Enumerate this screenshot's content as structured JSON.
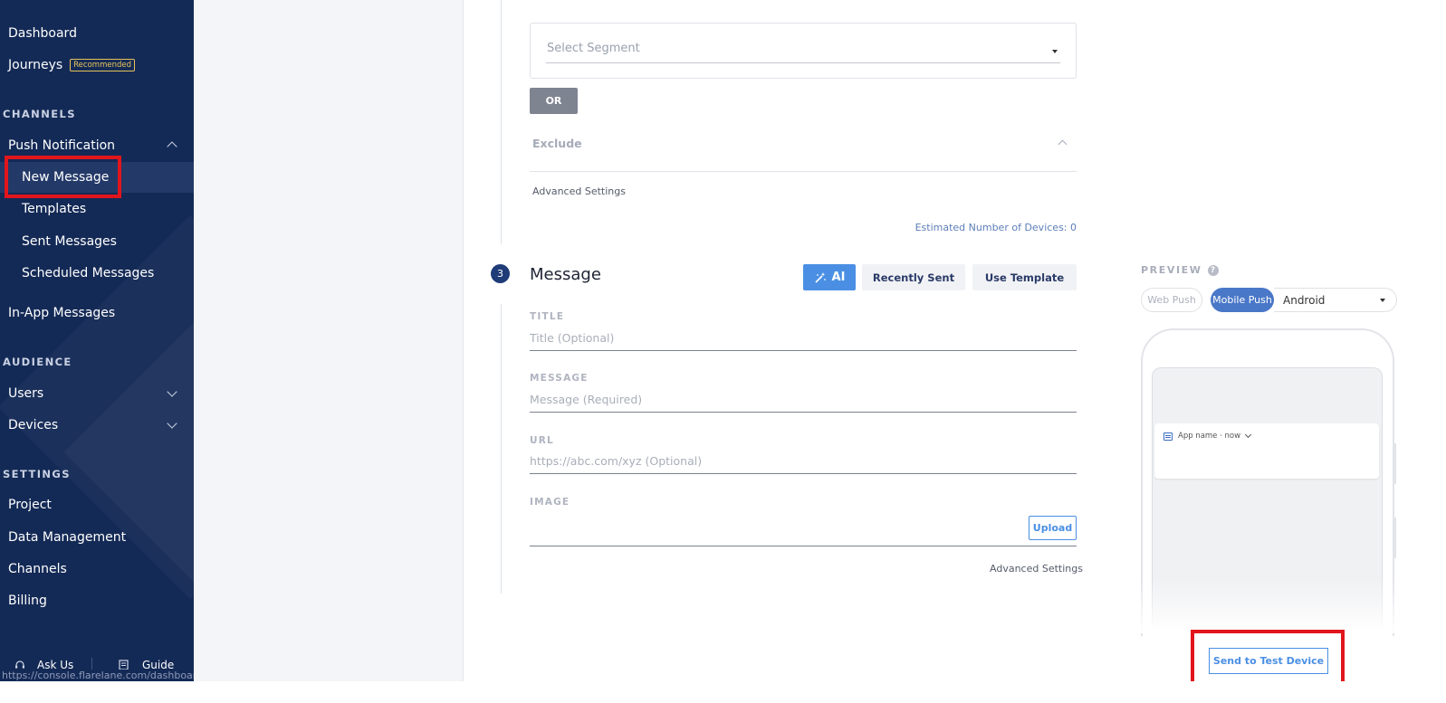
{
  "sidebar": {
    "nav_top": {
      "dashboard": "Dashboard",
      "journeys": "Journeys",
      "journeys_badge": "Recommended"
    },
    "sections": {
      "channels": "CHANNELS",
      "audience": "AUDIENCE",
      "settings": "SETTINGS"
    },
    "push": {
      "label": "Push Notification",
      "items": [
        "New Message",
        "Templates",
        "Sent Messages",
        "Scheduled Messages"
      ]
    },
    "in_app": "In-App Messages",
    "audience_items": [
      "Users",
      "Devices"
    ],
    "settings_items": [
      "Project",
      "Data Management",
      "Channels",
      "Billing"
    ],
    "footer": {
      "ask": "Ask Us",
      "guide": "Guide"
    },
    "status_url": "https://console.flarelane.com/dashboard"
  },
  "segment": {
    "select_placeholder": "Select Segment",
    "or_label": "OR",
    "exclude_label": "Exclude",
    "advanced_settings": "Advanced Settings",
    "estimated_devices": "Estimated Number of Devices: 0"
  },
  "message_step": {
    "number": "3",
    "title": "Message",
    "ai_label": "AI",
    "recently_sent": "Recently Sent",
    "use_template": "Use Template",
    "fields": {
      "title_label": "TITLE",
      "title_placeholder": "Title (Optional)",
      "message_label": "MESSAGE",
      "message_placeholder": "Message (Required)",
      "url_label": "URL",
      "url_placeholder": "https://abc.com/xyz (Optional)",
      "image_label": "IMAGE",
      "upload": "Upload"
    },
    "advanced_settings": "Advanced Settings"
  },
  "preview": {
    "label": "PREVIEW",
    "tabs": [
      "Web Push",
      "Mobile Push"
    ],
    "os_selected": "Android",
    "notification_header": "App name · now",
    "send_test": "Send to Test Device"
  },
  "colors": {
    "sidebar_bg": "#142a56",
    "accent_blue": "#4a8fe4",
    "highlight_red": "#e1151c"
  }
}
